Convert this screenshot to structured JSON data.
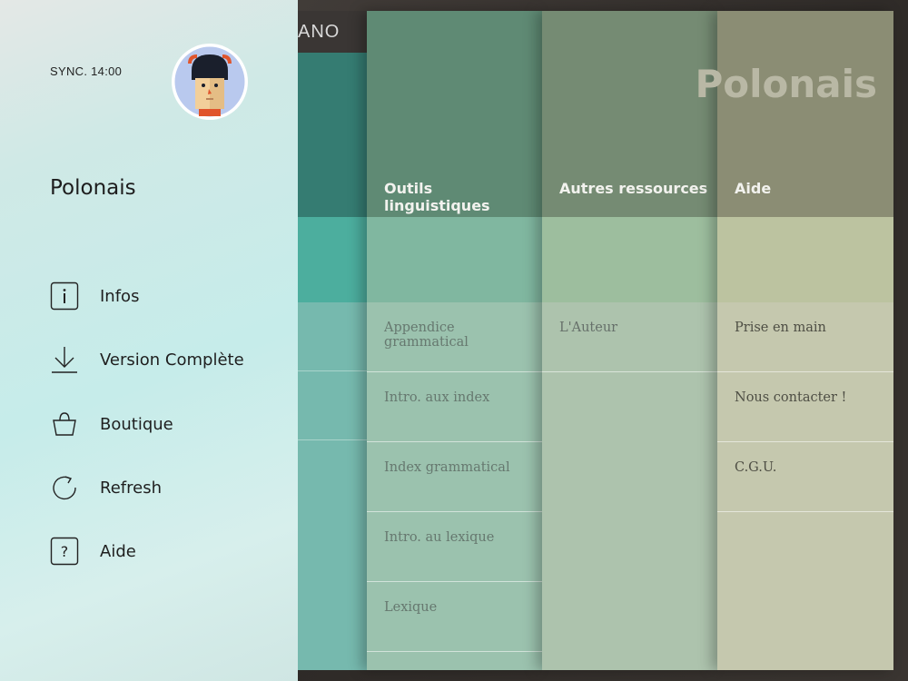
{
  "header": {
    "brand": "ANO"
  },
  "drawer": {
    "sync": "SYNC. 14:00",
    "language": "Polonais",
    "menu": [
      {
        "label": "Infos",
        "icon": "info-icon"
      },
      {
        "label": "Version Complète",
        "icon": "download-icon"
      },
      {
        "label": "Boutique",
        "icon": "basket-icon"
      },
      {
        "label": "Refresh",
        "icon": "refresh-icon"
      },
      {
        "label": "Aide",
        "icon": "help-icon"
      }
    ]
  },
  "main": {
    "page_title": "Polonais",
    "columns": [
      {
        "title": "Outils linguistiques",
        "items": [
          "Appendice grammatical",
          "Intro. aux index",
          "Index grammatical",
          "Intro. au lexique",
          "Lexique"
        ]
      },
      {
        "title": "Autres ressources",
        "items": [
          "L'Auteur"
        ]
      },
      {
        "title": "Aide",
        "items": [
          "Prise en main",
          "Nous contacter !",
          "C.G.U."
        ]
      }
    ]
  }
}
